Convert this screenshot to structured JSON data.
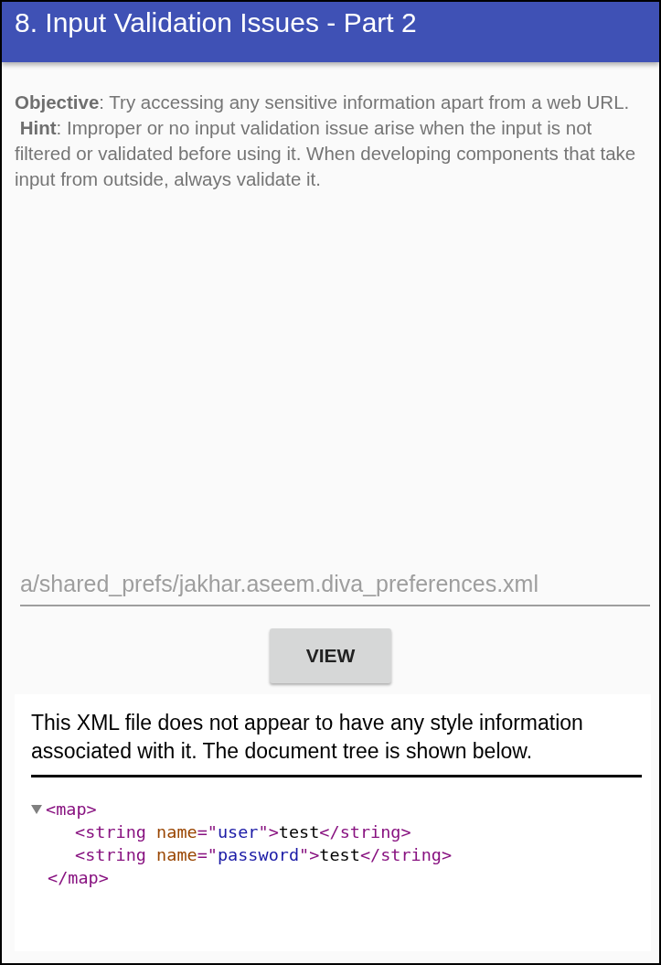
{
  "app_bar": {
    "title": "8. Input Validation Issues - Part 2"
  },
  "description": {
    "objective": "**Objective**: Try accessing any sensitive information apart from a web URL.",
    "hint": "**Hint**: Improper or no input validation issue arise when the input is not filtered or validated before using it. When developing components that take input from outside, always validate it."
  },
  "url_field": {
    "value": "a/shared_prefs/jakhar.aseem.diva_preferences.xml"
  },
  "view_button": {
    "label": "VIEW"
  },
  "webview": {
    "notice": "This XML file does not appear to have any style information associated with it. The document tree is shown below.",
    "xml_tree": {
      "expanded": true,
      "open_tag": "<map>",
      "close_tag": "</map>",
      "children": [
        {
          "parts": [
            {
              "kind": "tag",
              "text": "<string "
            },
            {
              "kind": "attr",
              "text": "name"
            },
            {
              "kind": "tag",
              "text": "=\""
            },
            {
              "kind": "value",
              "text": "user"
            },
            {
              "kind": "tag",
              "text": "\">"
            },
            {
              "kind": "text",
              "text": "test"
            },
            {
              "kind": "tag",
              "text": "</string>"
            }
          ]
        },
        {
          "parts": [
            {
              "kind": "tag",
              "text": "<string "
            },
            {
              "kind": "attr",
              "text": "name"
            },
            {
              "kind": "tag",
              "text": "=\""
            },
            {
              "kind": "value",
              "text": "password"
            },
            {
              "kind": "tag",
              "text": "\">"
            },
            {
              "kind": "text",
              "text": "test"
            },
            {
              "kind": "tag",
              "text": "</string>"
            }
          ]
        }
      ]
    }
  }
}
